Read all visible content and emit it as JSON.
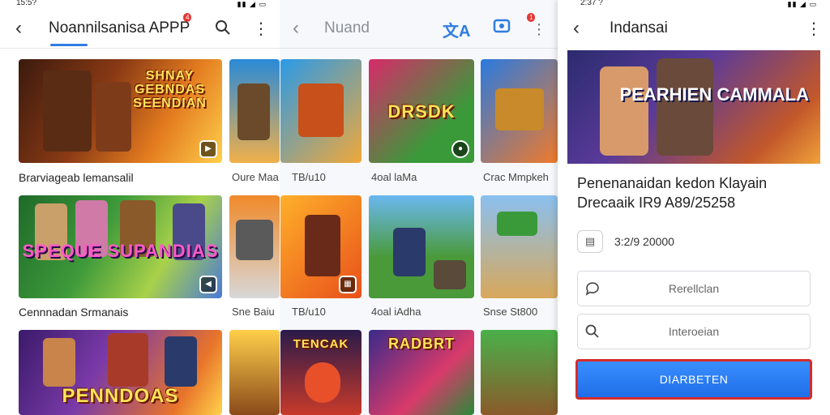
{
  "left_screen": {
    "status_time": "15:5?",
    "title": "Noannilsanisa APPP",
    "notification_badge": "4",
    "icons": [
      "back-arrow-icon",
      "search-icon",
      "more-vert-icon"
    ],
    "banners": [
      {
        "logo": "SHNAY GEBNDAS SEENDIAN",
        "caption": "Brarviageab lemansalil"
      },
      {
        "logo": "SPEQUE SUPANDIAS",
        "caption": "Cennnadan Srmanais"
      },
      {
        "logo": "PENNDOAS",
        "caption": ""
      }
    ],
    "peek_captions": [
      "Oure Maa",
      "Sne Baiu",
      ""
    ]
  },
  "middle_screen": {
    "title": "Nuand",
    "notification_badge": "1",
    "icons": [
      "back-arrow-icon",
      "translate-icon",
      "cast-icon",
      "more-vert-icon"
    ],
    "tiles": [
      {
        "label": "",
        "caption": "TB/u10"
      },
      {
        "label": "DRSDK",
        "caption": "4oal laMa"
      },
      {
        "label": "",
        "caption": "Crac Mmpkeh"
      },
      {
        "label": "",
        "caption": "TB/u10"
      },
      {
        "label": "",
        "caption": "4oal iAdha"
      },
      {
        "label": "",
        "caption": "Snse St800"
      },
      {
        "label": "TENCAK",
        "caption": ""
      },
      {
        "label": "RADBRT",
        "caption": ""
      },
      {
        "label": "",
        "caption": ""
      }
    ]
  },
  "right_screen": {
    "status_time": "2:37 ?",
    "title": "Indansai",
    "hero_logo": "PEARHIEN CAMMALA",
    "detail_title": "Penenanaidan kedon Klayain Drecaaik IR9 A89/25258",
    "info_date": "3:2/9 20000",
    "fields": [
      {
        "icon": "chat-bubble-icon",
        "text": "Rerellclan"
      },
      {
        "icon": "search-icon",
        "text": "Interoeian"
      }
    ],
    "cta_label": "DIARBETEN",
    "icons": [
      "back-arrow-icon",
      "more-vert-icon"
    ]
  }
}
